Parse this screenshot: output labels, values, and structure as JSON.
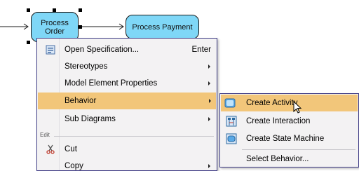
{
  "diagram": {
    "nodes": [
      {
        "label": "Process\nOrder",
        "selected": true
      },
      {
        "label": "Process Payment",
        "selected": false
      }
    ],
    "colors": {
      "node_fill": "#7fd7f7",
      "flow_line": "#1a1a1a",
      "menu_border": "#3e3b85",
      "highlight": "#f2c67a"
    }
  },
  "context_menu": {
    "items": [
      {
        "label": "Open Specification...",
        "shortcut": "Enter",
        "icon": "specification-icon"
      },
      {
        "label": "Stereotypes",
        "submenu": true
      },
      {
        "label": "Model Element Properties",
        "submenu": true
      },
      {
        "label": "Behavior",
        "submenu": true,
        "highlighted": true
      },
      {
        "label": "Sub Diagrams",
        "submenu": true
      }
    ],
    "section_label": "Edit",
    "edit_items": [
      {
        "label": "Cut",
        "icon": "scissors-icon"
      },
      {
        "label": "Copy",
        "submenu": true
      }
    ]
  },
  "behavior_submenu": {
    "items": [
      {
        "label": "Create Activity",
        "icon": "activity-diagram-icon",
        "highlighted": true
      },
      {
        "label": "Create Interaction",
        "icon": "interaction-diagram-icon"
      },
      {
        "label": "Create State Machine",
        "icon": "state-machine-diagram-icon"
      },
      {
        "label": "Select Behavior..."
      }
    ]
  }
}
